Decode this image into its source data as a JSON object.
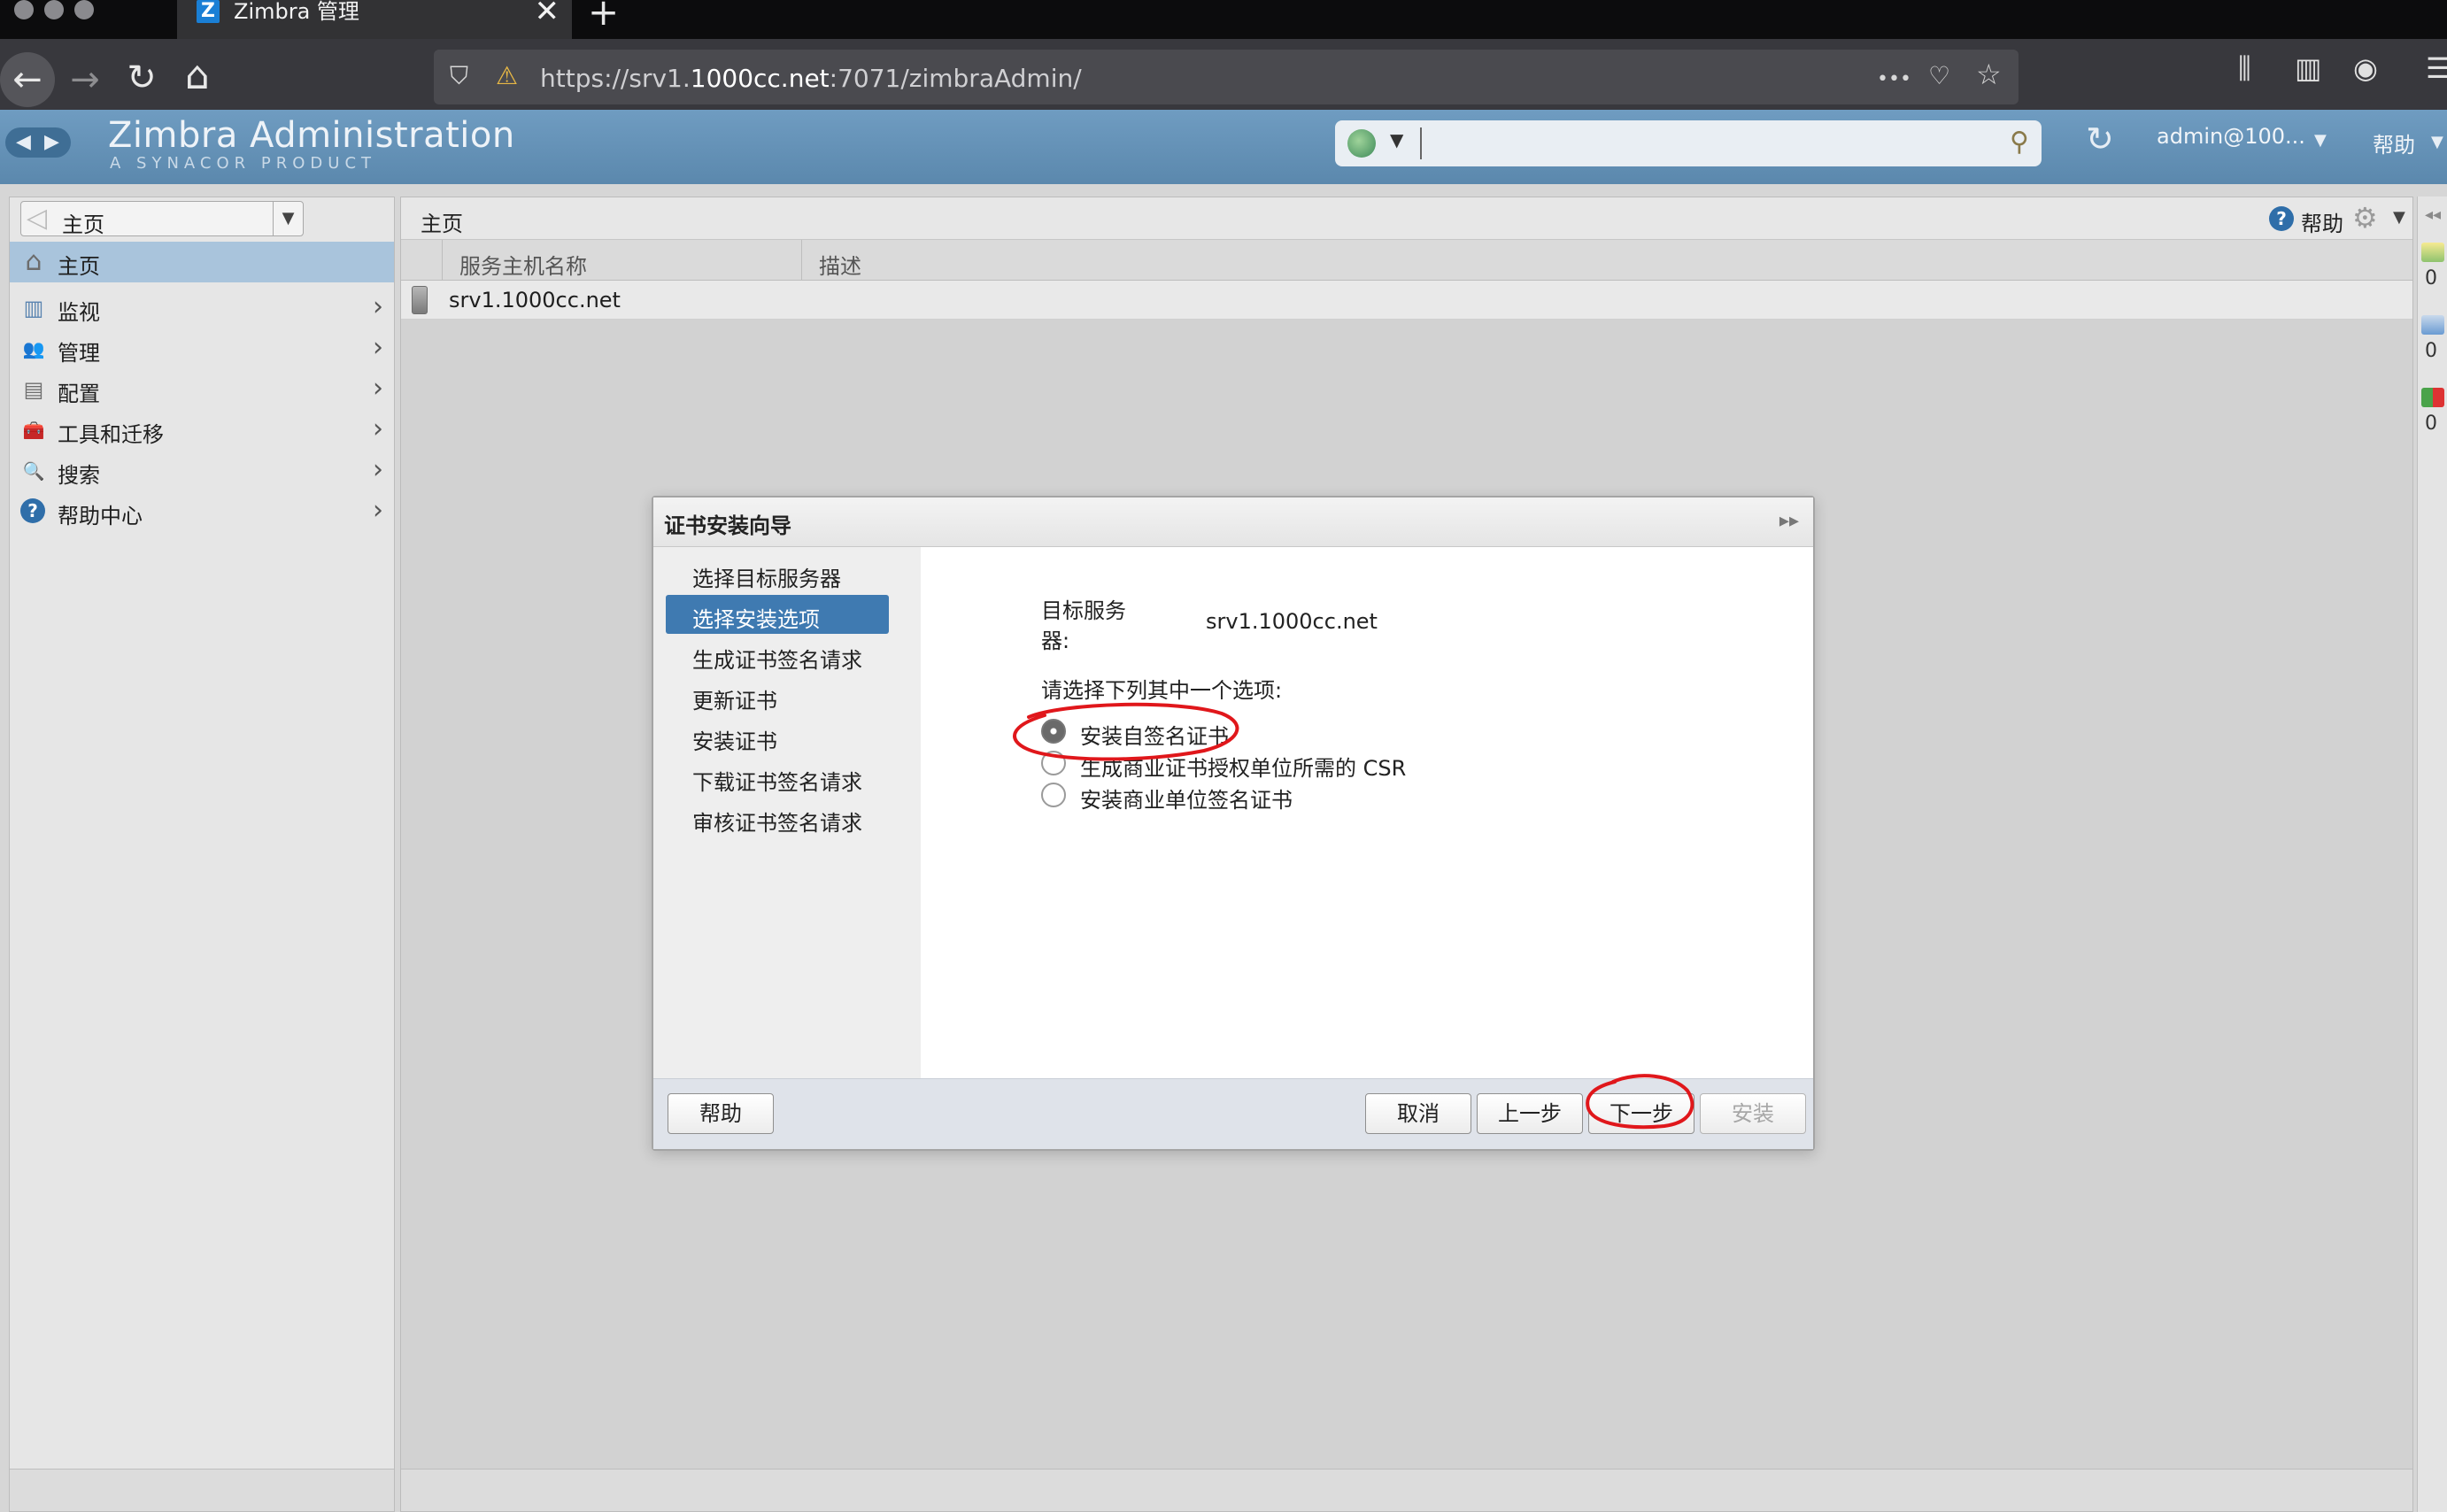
{
  "browser": {
    "tab_title": "Zimbra 管理",
    "tab_favicon_letter": "Z",
    "url_prefix": "https://srv1.",
    "url_domain": "1000cc.net",
    "url_suffix": ":7071/zimbraAdmin/",
    "icons": {
      "back": "←",
      "forward": "→",
      "reload": "↻",
      "home": "⌂",
      "shield": "⛉",
      "lock_warning": "⚠",
      "more": "•••",
      "pocket": "♡",
      "bookmark": "☆",
      "library": "⫼",
      "sidebar": "▥",
      "account": "◉",
      "menu": "☰",
      "new_tab": "+",
      "close_tab": "✕"
    }
  },
  "zimbra_header": {
    "title": "Zimbra Administration",
    "subtitle": "A SYNACOR PRODUCT",
    "search_value": "",
    "user": "admin@100...",
    "help": "帮助"
  },
  "sidebar": {
    "breadcrumb": "主页",
    "items": [
      {
        "label": "主页",
        "icon": "home-icon",
        "glyph": "⌂"
      },
      {
        "label": "监视",
        "icon": "monitor-icon",
        "glyph": "▥"
      },
      {
        "label": "管理",
        "icon": "manage-users-icon",
        "glyph": "👥"
      },
      {
        "label": "配置",
        "icon": "configure-icon",
        "glyph": "▤"
      },
      {
        "label": "工具和迁移",
        "icon": "toolbox-icon",
        "glyph": "🧰"
      },
      {
        "label": "搜索",
        "icon": "search-icon",
        "glyph": "🔍"
      },
      {
        "label": "帮助中心",
        "icon": "help-center-icon",
        "glyph": "?"
      }
    ]
  },
  "main": {
    "title": "主页",
    "help": "帮助",
    "columns": [
      "服务主机名称",
      "描述"
    ],
    "rows": [
      {
        "host": "srv1.1000cc.net",
        "description": ""
      }
    ]
  },
  "right_strip": {
    "counts": [
      "0",
      "0",
      "0"
    ]
  },
  "wizard": {
    "title": "证书安装向导",
    "steps": [
      "选择目标服务器",
      "选择安装选项",
      "生成证书签名请求",
      "更新证书",
      "安装证书",
      "下载证书签名请求",
      "审核证书签名请求"
    ],
    "active_step": 1,
    "target_label_line1": "目标服务",
    "target_label_line2": "器:",
    "target_value": "srv1.1000cc.net",
    "prompt": "请选择下列其中一个选项:",
    "options": [
      {
        "label": "安装自签名证书",
        "selected": true
      },
      {
        "label": "生成商业证书授权单位所需的 CSR",
        "selected": false
      },
      {
        "label": "安装商业单位签名证书",
        "selected": false
      }
    ],
    "buttons": {
      "help": "帮助",
      "cancel": "取消",
      "prev": "上一步",
      "next": "下一步",
      "install": "安装"
    }
  },
  "colors": {
    "zimbra_header": "#6a97bc",
    "selected": "#3f7ab1",
    "annotation": "#e0171b"
  }
}
